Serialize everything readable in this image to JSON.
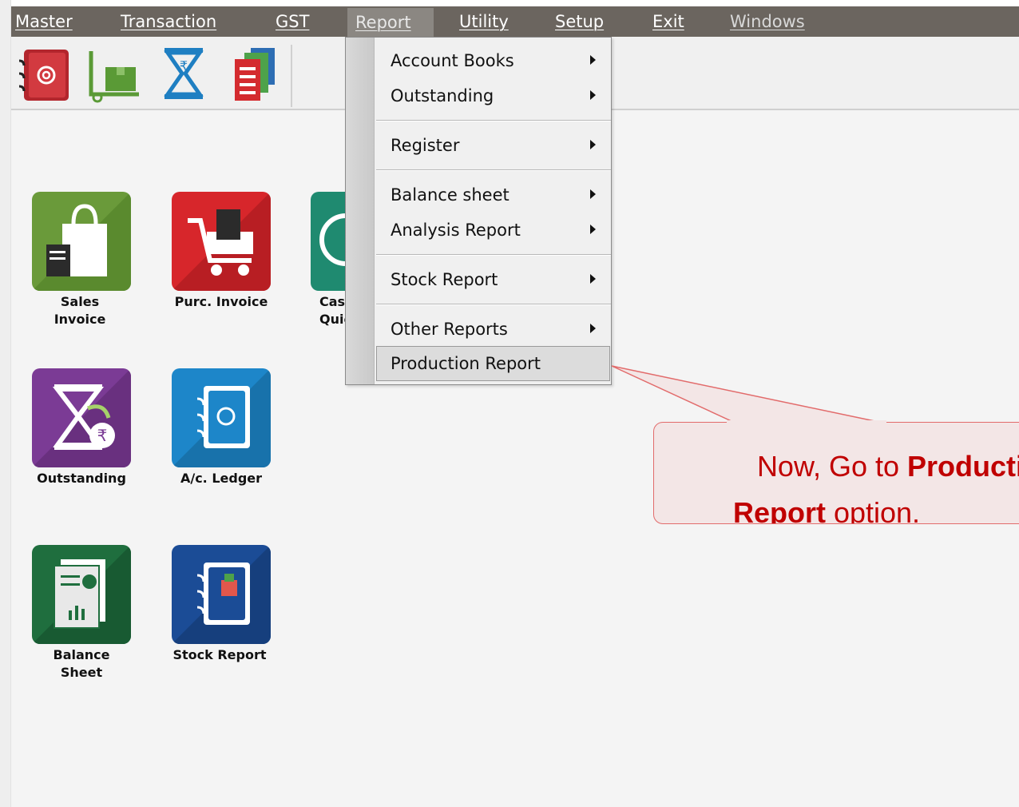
{
  "menubar": {
    "items": [
      "Master",
      "Transaction",
      "GST",
      "Report",
      "Utility",
      "Setup",
      "Exit",
      "Windows"
    ],
    "active": "Report"
  },
  "toolbar": {
    "icons": [
      "address-book-icon",
      "stock-trolley-icon",
      "hourglass-rupee-icon",
      "report-pages-icon"
    ]
  },
  "tiles": [
    {
      "label": "Sales\nInvoice",
      "icon": "shopping-bag-icon",
      "color": "#6a9a3a"
    },
    {
      "label": "Purc. Invoice",
      "icon": "cart-icon",
      "color": "#d7262b"
    },
    {
      "label": "Cas\nQuic",
      "icon": "cash-quick-icon",
      "color": "#1f8a70"
    },
    {
      "label": "Outstanding",
      "icon": "hourglass-rupee-icon",
      "color": "#7b3b95"
    },
    {
      "label": "A/c. Ledger",
      "icon": "address-book-icon",
      "color": "#1d86c9"
    },
    {
      "label": "Balance\nSheet",
      "icon": "balance-report-icon",
      "color": "#1f6e3e"
    },
    {
      "label": "Stock Report",
      "icon": "stock-notebook-icon",
      "color": "#1b4c96"
    }
  ],
  "report_menu": {
    "items": [
      {
        "label": "Account Books",
        "submenu": true
      },
      {
        "label": "Outstanding",
        "submenu": true
      },
      {
        "label": "Register",
        "submenu": true
      },
      {
        "label": "Balance sheet",
        "submenu": true
      },
      {
        "label": "Analysis Report",
        "submenu": true
      },
      {
        "label": "Stock Report",
        "submenu": true
      },
      {
        "label": "Other Reports",
        "submenu": true
      },
      {
        "label": "Production Report",
        "submenu": false,
        "highlighted": true
      }
    ]
  },
  "callout": {
    "prefix": "Now, Go to ",
    "bold1": "Producti",
    "bold2": "Report",
    "suffix": " option.",
    "color": "#c00000"
  }
}
